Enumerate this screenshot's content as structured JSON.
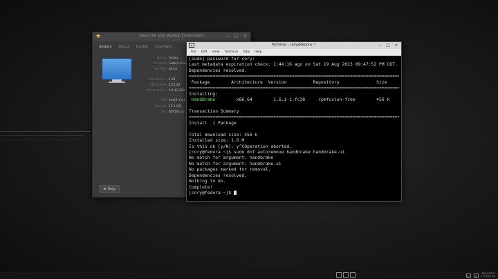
{
  "about": {
    "title": "About the Xfce Desktop Environment",
    "tabs": [
      "System",
      "About",
      "Credits",
      "Copyright"
    ],
    "rows": [
      {
        "label": "Device",
        "value": "fedora"
      },
      {
        "label": "OS Name",
        "value": "Fedora Linux"
      },
      {
        "label": "OS Type",
        "value": "64-bit"
      },
      {
        "label": "Xfce Version",
        "value": "4.18"
      },
      {
        "label": "GTK Version",
        "value": "3.24.38"
      },
      {
        "label": "Kernel Version",
        "value": "6.4.11-200"
      },
      {
        "label": "CPU",
        "value": "Intel® Core"
      },
      {
        "label": "Memory",
        "value": "15.5 GiB"
      },
      {
        "label": "GPU",
        "value": "NVIDIA Cor"
      }
    ],
    "help_label": "Help"
  },
  "terminal": {
    "title": "Terminal - cory@fedora:~",
    "menu": [
      "File",
      "Edit",
      "View",
      "Terminal",
      "Tabs",
      "Help"
    ],
    "lines": [
      "[sudo] password for cory:",
      "Last metadata expiration check: 1:44:16 ago on Sat 19 Aug 2023 09:47:52 PM CDT.",
      "Dependencies resolved.",
      "================================================================================",
      " Package        Architecture  Version          Repository              Size",
      "================================================================================",
      "Installing:",
      " HandBrake        x86_64        1.6.1-1.fc38     rpmfusion-free        456 k",
      "",
      "Transaction Summary",
      "================================================================================",
      "Install  1 Package",
      "",
      "Total download size: 456 k",
      "Installed size: 1.6 M",
      "Is this ok [y/N]: y^COperation aborted.",
      "[cory@fedora ~]$ sudo dnf autoremove handbrake handbrake-ui",
      "No match for argument: handbrake",
      "No match for argument: handbrake-ui",
      "No packages marked for removal.",
      "Dependencies resolved.",
      "Nothing to do.",
      "Complete!",
      "[cory@fedora ~]$ "
    ],
    "handbrake_name": "HandBrake"
  },
  "taskbar": {
    "clock_date": "08/19/2023",
    "clock_time": "11:34:26 pm"
  },
  "colors": {
    "terminal_bg": "#000000",
    "package_highlight": "#6ef25f"
  }
}
